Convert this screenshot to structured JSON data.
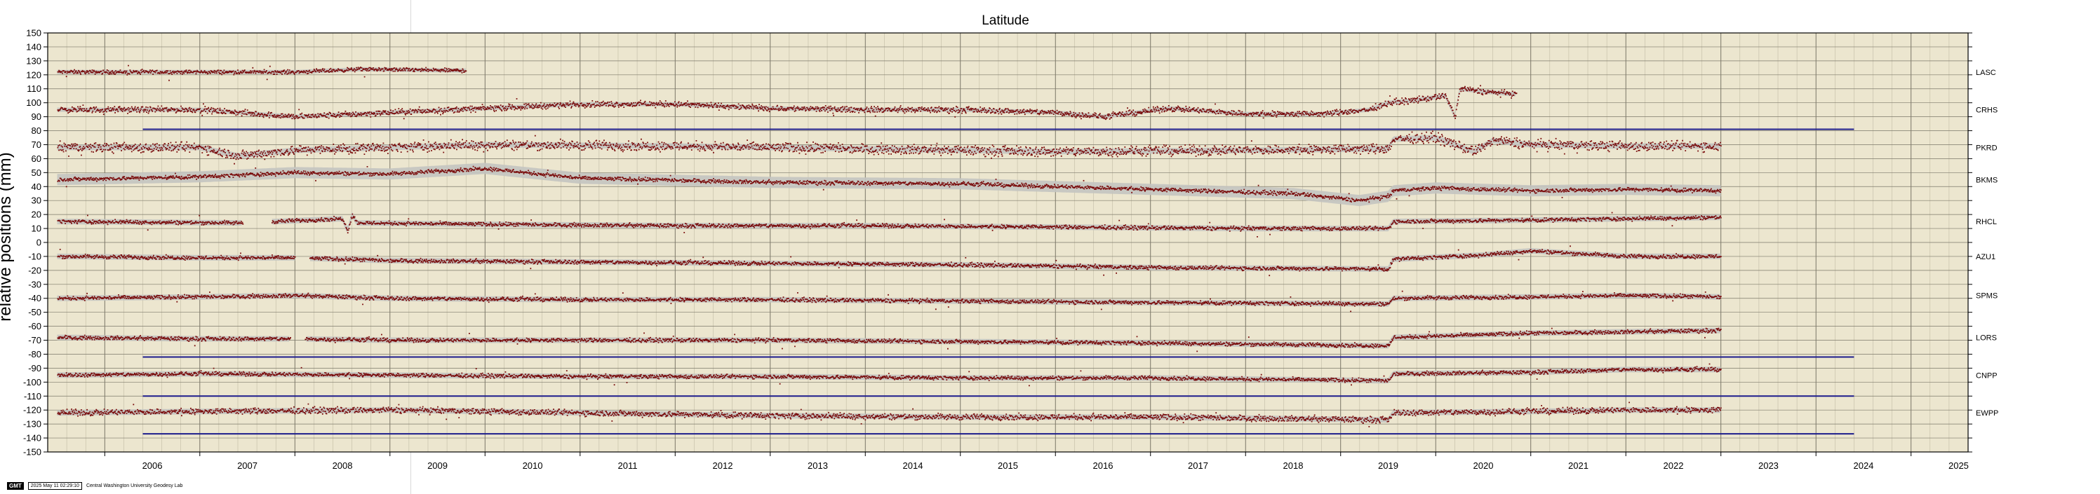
{
  "chart_data": {
    "type": "scatter",
    "title": "Latitude",
    "xlabel": "",
    "ylabel": "relative positions (mm)",
    "xlim": [
      2005.4,
      2025.6
    ],
    "ylim": [
      -150,
      150
    ],
    "xticks": [
      2006,
      2007,
      2008,
      2009,
      2010,
      2011,
      2012,
      2013,
      2014,
      2015,
      2016,
      2017,
      2018,
      2019,
      2020,
      2021,
      2022,
      2023,
      2024,
      2025
    ],
    "yticks": [
      150,
      140,
      130,
      120,
      110,
      100,
      90,
      80,
      70,
      60,
      50,
      40,
      30,
      20,
      10,
      0,
      -10,
      -20,
      -30,
      -40,
      -50,
      -60,
      -70,
      -80,
      -90,
      -100,
      -110,
      -120,
      -130,
      -140,
      -150
    ],
    "grid": true,
    "colors": {
      "points": "#7a0c0c",
      "error_band": "#c4c4c0",
      "reference_line": "#1c1c8c",
      "background": "#ece6cf"
    },
    "series": [
      {
        "name": "LASC",
        "offset": 122,
        "start": 2005.5,
        "end": 2009.8,
        "gaps": [],
        "trend": [
          [
            2005.5,
            122
          ],
          [
            2007.0,
            122
          ],
          [
            2008.0,
            122
          ],
          [
            2008.7,
            124
          ],
          [
            2009.8,
            123
          ]
        ],
        "band": 1.5,
        "noise": 1.0
      },
      {
        "name": "CRHS",
        "offset": 95,
        "start": 2005.5,
        "end": 2020.85,
        "gaps": [],
        "trend": [
          [
            2005.5,
            95
          ],
          [
            2007.0,
            95
          ],
          [
            2008.0,
            90
          ],
          [
            2009.0,
            93
          ],
          [
            2010.0,
            96
          ],
          [
            2011.0,
            99
          ],
          [
            2012.0,
            99
          ],
          [
            2013.0,
            96
          ],
          [
            2014.0,
            95
          ],
          [
            2015.0,
            95
          ],
          [
            2016.0,
            93
          ],
          [
            2016.5,
            90
          ],
          [
            2017.2,
            96
          ],
          [
            2018.0,
            92
          ],
          [
            2018.8,
            92
          ],
          [
            2019.3,
            95
          ],
          [
            2019.5,
            100
          ],
          [
            2019.8,
            102
          ],
          [
            2020.1,
            105
          ],
          [
            2020.2,
            90
          ],
          [
            2020.25,
            110
          ],
          [
            2020.5,
            108
          ],
          [
            2020.85,
            106
          ]
        ],
        "band": 1.5,
        "noise": 1.5
      },
      {
        "name": "PKRD",
        "offset": 68,
        "start": 2005.5,
        "end": 2023.0,
        "gaps": [],
        "trend": [
          [
            2005.5,
            68
          ],
          [
            2007.0,
            68
          ],
          [
            2007.4,
            62
          ],
          [
            2008.0,
            66
          ],
          [
            2009.0,
            68
          ],
          [
            2010.0,
            70
          ],
          [
            2012.0,
            69
          ],
          [
            2014.0,
            67
          ],
          [
            2016.0,
            65
          ],
          [
            2018.0,
            66
          ],
          [
            2019.5,
            67
          ],
          [
            2019.55,
            74
          ],
          [
            2020.0,
            75
          ],
          [
            2020.4,
            65
          ],
          [
            2020.6,
            73
          ],
          [
            2021.0,
            70
          ],
          [
            2022.0,
            69
          ],
          [
            2023.0,
            69
          ]
        ],
        "band": 2,
        "noise": 2.5
      },
      {
        "name": "BKMS",
        "offset": 45,
        "start": 2005.5,
        "end": 2023.0,
        "gaps": [],
        "trend": [
          [
            2005.5,
            45
          ],
          [
            2007.0,
            47
          ],
          [
            2008.0,
            50
          ],
          [
            2009.0,
            49
          ],
          [
            2010.0,
            53
          ],
          [
            2011.0,
            46
          ],
          [
            2013.0,
            43
          ],
          [
            2015.0,
            42
          ],
          [
            2017.0,
            38
          ],
          [
            2018.5,
            35
          ],
          [
            2019.2,
            30
          ],
          [
            2019.5,
            33
          ],
          [
            2019.55,
            37
          ],
          [
            2020.0,
            39
          ],
          [
            2021.0,
            37
          ],
          [
            2022.0,
            38
          ],
          [
            2023.0,
            37
          ]
        ],
        "band": 4,
        "noise": 1.0
      },
      {
        "name": "RHCL",
        "offset": 15,
        "start": 2005.5,
        "end": 2023.0,
        "gaps": [
          [
            2007.45,
            2007.75
          ]
        ],
        "trend": [
          [
            2005.5,
            15
          ],
          [
            2007.4,
            14
          ],
          [
            2007.8,
            15
          ],
          [
            2008.5,
            17
          ],
          [
            2008.55,
            8
          ],
          [
            2008.6,
            20
          ],
          [
            2008.65,
            14
          ],
          [
            2010.0,
            13
          ],
          [
            2012.0,
            12
          ],
          [
            2014.0,
            12
          ],
          [
            2016.0,
            11
          ],
          [
            2018.0,
            10
          ],
          [
            2019.5,
            10
          ],
          [
            2019.55,
            15
          ],
          [
            2021.0,
            16
          ],
          [
            2023.0,
            18
          ]
        ],
        "band": 2,
        "noise": 1.0
      },
      {
        "name": "AZU1",
        "offset": -10,
        "start": 2005.5,
        "end": 2023.0,
        "gaps": [
          [
            2008.0,
            2008.15
          ]
        ],
        "trend": [
          [
            2005.5,
            -10
          ],
          [
            2007.0,
            -11
          ],
          [
            2008.0,
            -11
          ],
          [
            2009.0,
            -13
          ],
          [
            2011.0,
            -14
          ],
          [
            2013.0,
            -15
          ],
          [
            2015.0,
            -16
          ],
          [
            2017.0,
            -18
          ],
          [
            2019.5,
            -19
          ],
          [
            2019.55,
            -12
          ],
          [
            2020.5,
            -9
          ],
          [
            2021.0,
            -6
          ],
          [
            2021.5,
            -8
          ],
          [
            2022.0,
            -10
          ],
          [
            2023.0,
            -10
          ]
        ],
        "band": 2,
        "noise": 1.0
      },
      {
        "name": "SPMS",
        "offset": -38,
        "start": 2005.5,
        "end": 2023.0,
        "gaps": [],
        "trend": [
          [
            2005.5,
            -40
          ],
          [
            2007.0,
            -39
          ],
          [
            2008.0,
            -38
          ],
          [
            2009.0,
            -40
          ],
          [
            2011.0,
            -41
          ],
          [
            2013.0,
            -41
          ],
          [
            2015.0,
            -42
          ],
          [
            2017.0,
            -43
          ],
          [
            2019.5,
            -44
          ],
          [
            2019.55,
            -40
          ],
          [
            2021.0,
            -39
          ],
          [
            2022.0,
            -38
          ],
          [
            2023.0,
            -39
          ]
        ],
        "band": 2,
        "noise": 1.0
      },
      {
        "name": "LORS",
        "offset": -68,
        "start": 2005.5,
        "end": 2023.0,
        "gaps": [
          [
            2007.95,
            2008.1
          ]
        ],
        "trend": [
          [
            2005.5,
            -68
          ],
          [
            2007.0,
            -69
          ],
          [
            2008.0,
            -69
          ],
          [
            2009.0,
            -70
          ],
          [
            2011.0,
            -70
          ],
          [
            2013.0,
            -70
          ],
          [
            2015.0,
            -71
          ],
          [
            2017.0,
            -72
          ],
          [
            2019.5,
            -74
          ],
          [
            2019.55,
            -68
          ],
          [
            2021.0,
            -65
          ],
          [
            2023.0,
            -63
          ]
        ],
        "band": 2,
        "noise": 1.0
      },
      {
        "name": "CNPP",
        "offset": -95,
        "start": 2005.5,
        "end": 2023.0,
        "gaps": [],
        "trend": [
          [
            2005.5,
            -95
          ],
          [
            2007.0,
            -94
          ],
          [
            2009.0,
            -95
          ],
          [
            2011.0,
            -96
          ],
          [
            2013.0,
            -96
          ],
          [
            2015.0,
            -97
          ],
          [
            2017.0,
            -97
          ],
          [
            2019.5,
            -99
          ],
          [
            2019.55,
            -94
          ],
          [
            2021.0,
            -93
          ],
          [
            2022.0,
            -91
          ],
          [
            2023.0,
            -91
          ]
        ],
        "band": 2,
        "noise": 1.0
      },
      {
        "name": "EWPP",
        "offset": -122,
        "start": 2005.5,
        "end": 2023.0,
        "gaps": [],
        "trend": [
          [
            2005.5,
            -122
          ],
          [
            2007.0,
            -121
          ],
          [
            2009.0,
            -120
          ],
          [
            2011.0,
            -122
          ],
          [
            2013.0,
            -124
          ],
          [
            2015.0,
            -125
          ],
          [
            2017.0,
            -125
          ],
          [
            2019.5,
            -127
          ],
          [
            2019.55,
            -122
          ],
          [
            2021.0,
            -121
          ],
          [
            2022.0,
            -120
          ],
          [
            2023.0,
            -120
          ]
        ],
        "band": 2,
        "noise": 1.5
      }
    ],
    "reference_lines": [
      {
        "y": 81,
        "x_start": 2006.4,
        "x_end": 2024.4
      },
      {
        "y": -82,
        "x_start": 2006.4,
        "x_end": 2024.4
      },
      {
        "y": -110,
        "x_start": 2006.4,
        "x_end": 2024.4
      },
      {
        "y": -137,
        "x_start": 2006.4,
        "x_end": 2024.4
      }
    ]
  },
  "footer": {
    "logo": "GMT",
    "timestamp": "2025 May 11 02:29:10",
    "credit": "Central Washington University Geodesy Lab"
  }
}
